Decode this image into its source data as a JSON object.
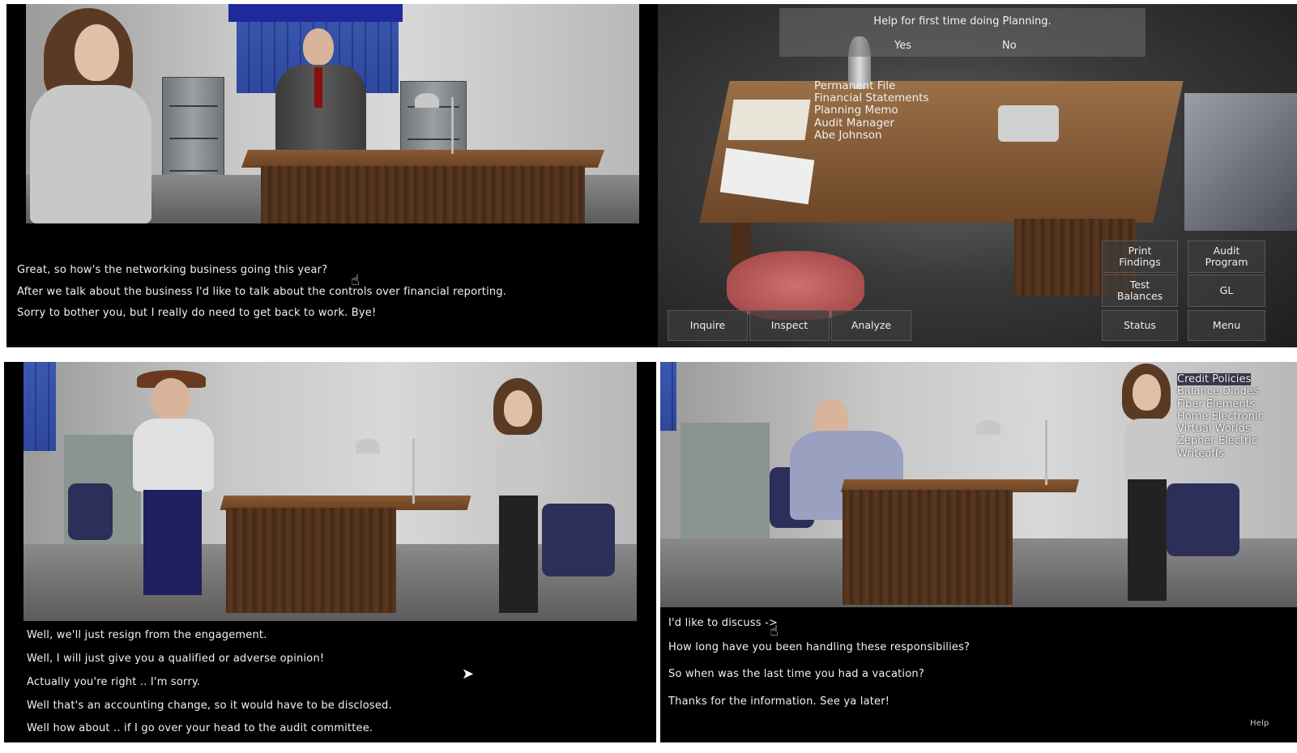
{
  "panel1": {
    "lines": [
      "Great, so how's the networking business going this year?",
      "After we talk about the business I'd like to talk about the controls over financial reporting.",
      "Sorry to bother you, but I really do need to get back to work.  Bye!"
    ]
  },
  "panel2": {
    "help_title": "Help for first time doing Planning.",
    "help_yes": "Yes",
    "help_no": "No",
    "desk_items": [
      "Permanent File",
      "Financial Statements",
      "Planning Memo",
      "Audit Manager",
      "Abe Johnson"
    ],
    "buttons": {
      "print_findings": "Print\nFindings",
      "audit_program": "Audit\nProgram",
      "test_balances": "Test\nBalances",
      "gl": "GL",
      "status": "Status",
      "menu": "Menu",
      "inquire": "Inquire",
      "inspect": "Inspect",
      "analyze": "Analyze"
    }
  },
  "panel3": {
    "lines": [
      "Well, we'll just resign from the engagement.",
      "Well, I will just give you a qualified or adverse opinion!",
      "Actually you're right .. I'm sorry.",
      "Well that's an accounting change, so it would have to be disclosed.",
      "Well how about .. if I go over your head to the audit committee."
    ]
  },
  "panel4": {
    "topics": [
      "Credit Policies",
      "Balance Diodes",
      "Fiber Elements",
      "Home Electronic",
      "Virtual Worlds",
      "Zepher Electric",
      "Writeoffs"
    ],
    "lines": [
      "I'd like to discuss ->",
      "How long have you been handling these responsibilies?",
      "So when was the last time you had a vacation?",
      "Thanks for the information.  See ya later!"
    ],
    "help_label": "Help"
  },
  "colors": {
    "dialog_bg": "#000000",
    "text": "#f2f2f2",
    "button_bg": "#3c3c3c",
    "selection": "#3b3b55"
  }
}
